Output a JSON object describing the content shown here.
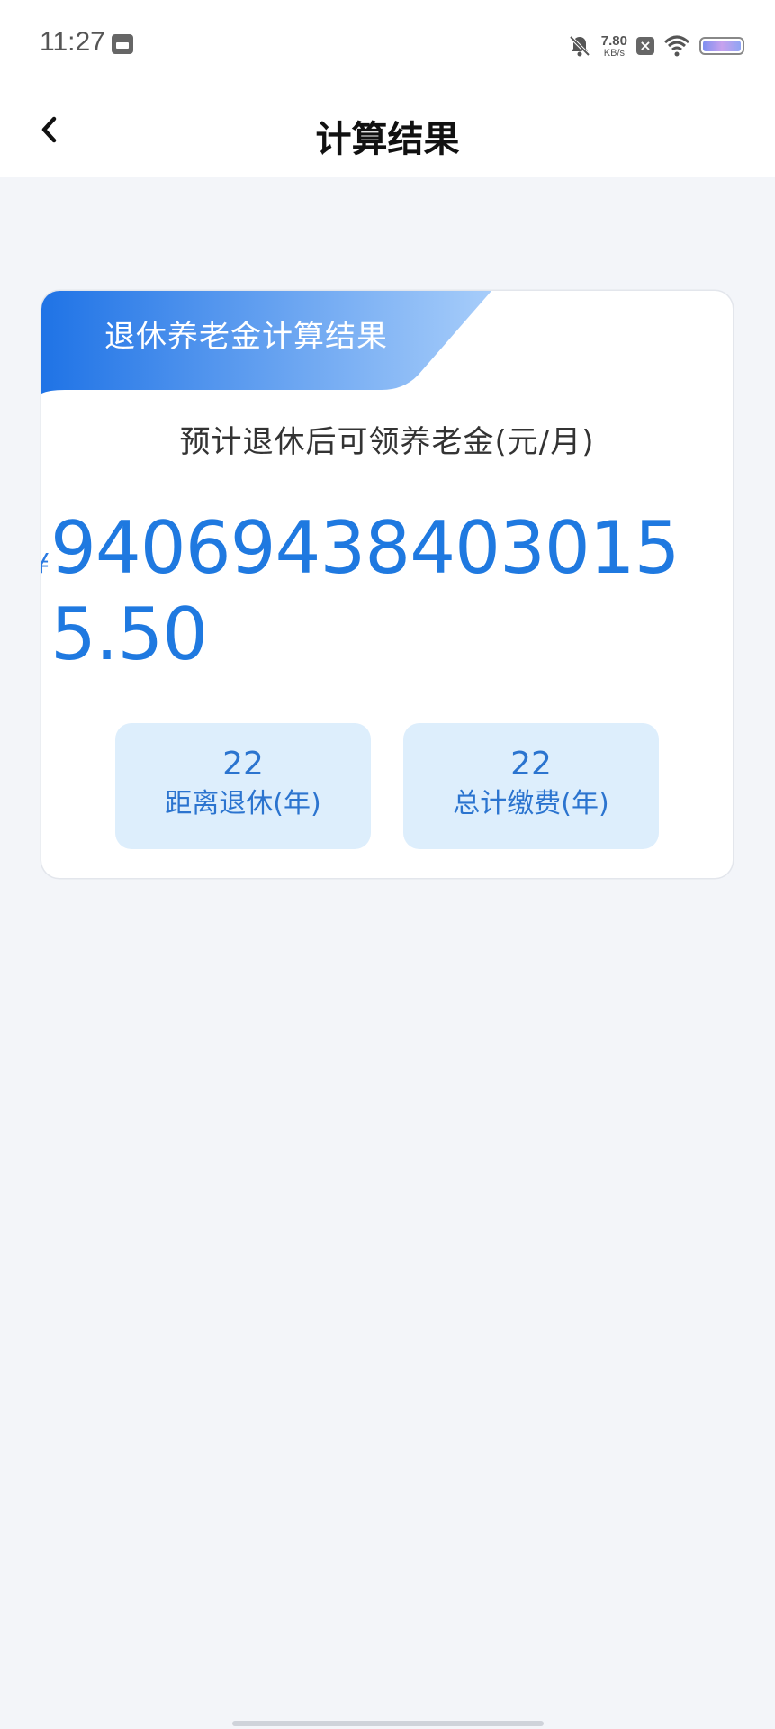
{
  "status_bar": {
    "time": "11:27",
    "net_speed_value": "7.80",
    "net_speed_unit": "KB/s",
    "icons": [
      "calendar-icon",
      "mute-icon",
      "close-icon",
      "wifi-icon",
      "battery-icon"
    ]
  },
  "header": {
    "title": "计算结果",
    "back_icon": "chevron-left-icon"
  },
  "result_card": {
    "banner_title": "退休养老金计算结果",
    "subtitle": "预计退休后可领养老金(元/月)",
    "currency_symbol": "¥",
    "amount": "940694384030155.50",
    "stats": [
      {
        "value": "22",
        "label": "距离退休(年)"
      },
      {
        "value": "22",
        "label": "总计缴费(年)"
      }
    ]
  },
  "colors": {
    "accent": "#1f79e0",
    "banner_gradient_start": "#1f73e6",
    "banner_gradient_end": "#a7cdfa",
    "stat_box_bg": "#ddeefc",
    "page_bg": "#f3f5f9"
  }
}
